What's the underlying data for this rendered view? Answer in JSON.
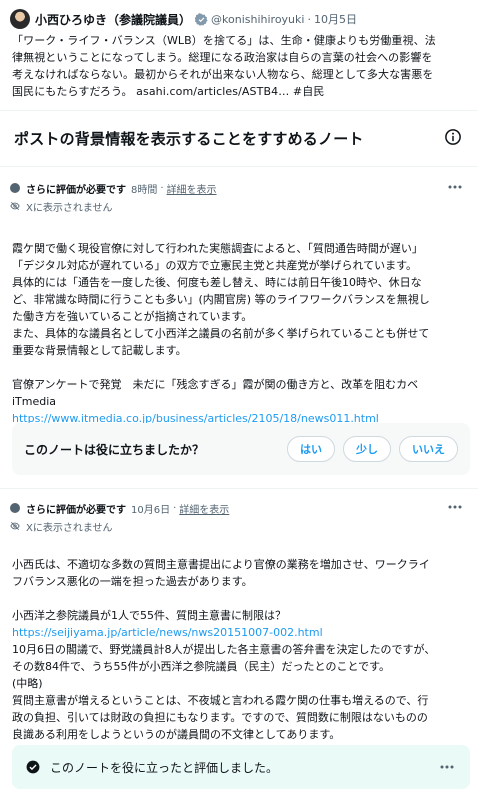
{
  "post": {
    "author": "小西ひろゆき（参議院議員）",
    "handle": "@konishihiroyuki",
    "separator": "·",
    "date": "10月5日",
    "lines": [
      "「ワーク・ライフ・バランス（WLB）を捨てる」は、生命・健康よりも労働重視、法",
      "律無視ということになってしまう。総理になる政治家は自らの言葉の社会への影響を",
      "考えなければならない。最初からそれが出来ない人物なら、総理として多大な害悪を"
    ],
    "last_line_text": "国民にもたらすだろう。 ",
    "link": "asahi.com/articles/ASTB4…",
    "hashtag": " #自民"
  },
  "notes_section": {
    "title": "ポストの背景情報を表示することをすすめるノート"
  },
  "notes": [
    {
      "status": "さらに評価が必要です",
      "time": "8時間",
      "separator": "·",
      "detail_link": "詳細を表示",
      "visibility": "Xに表示されません",
      "paragraphs": [
        "霞ケ関で働く現役官僚に対して行われた実態調査によると、「質問通告時間が遅い」",
        "「デジタル対応が遅れている」の双方で立憲民主党と共産党が挙げられています。",
        "具体的には「通告を一度した後、何度も差し替え、時には前日午後10時や、休日な",
        "ど、非常識な時間に行うことも多い」(内閣官房) 等のライフワークバランスを無視し",
        "た働き方を強いていることが指摘されています。",
        "また、具体的な議員名として小西洋之議員の名前が多く挙げられていることも併せて",
        "重要な背景情報として記載します。",
        "",
        "官僚アンケートで発覚　未だに「残念すぎる」霞が関の働き方と、改革を阻むカベ",
        "iTmedia"
      ],
      "url": "https://www.itmedia.co.jp/business/articles/2105/18/news011.html",
      "rating": {
        "question": "このノートは役に立ちましたか？",
        "yes": "はい",
        "somewhat": "少し",
        "no": "いいえ"
      }
    },
    {
      "status": "さらに評価が必要です",
      "time": "10月6日",
      "separator": "·",
      "detail_link": "詳細を表示",
      "visibility": "Xに表示されません",
      "paragraphs_a": [
        "小西氏は、不適切な多数の質問主意書提出により官僚の業務を増加させ、ワークライ",
        "フバランス悪化の一端を担った過去があります。",
        "",
        "小西洋之参院議員が1人で55件、質問主意書に制限は？"
      ],
      "url": "https://seijiyama.jp/article/news/nws20151007-002.html",
      "paragraphs_b": [
        "10月6日の閣議で、野党議員計8人が提出した各主意書の答弁書を決定したのですが、",
        "その数84件で、うち55件が小西洋之参院議員（民主）だったとのことです。",
        "(中略)",
        "質問主意書が増えるということは、不夜城と言われる霞ケ関の仕事も増えるので、行",
        "政の負担、引いては財政の負担にもなります。ですので、質問数に制限はないものの",
        "良識ある利用をしようというのが議員間の不文律としてあります。"
      ],
      "rated_text": "このノートを役に立ったと評価しました。"
    }
  ],
  "colors": {
    "accent": "#1d9bf0",
    "muted": "#536471",
    "rated_bg": "#eafaf6",
    "rate_bg": "#f7f9f9"
  },
  "icons": [
    "verified-badge-icon",
    "info-icon",
    "more-icon",
    "eye-off-icon",
    "check-circle-icon"
  ]
}
